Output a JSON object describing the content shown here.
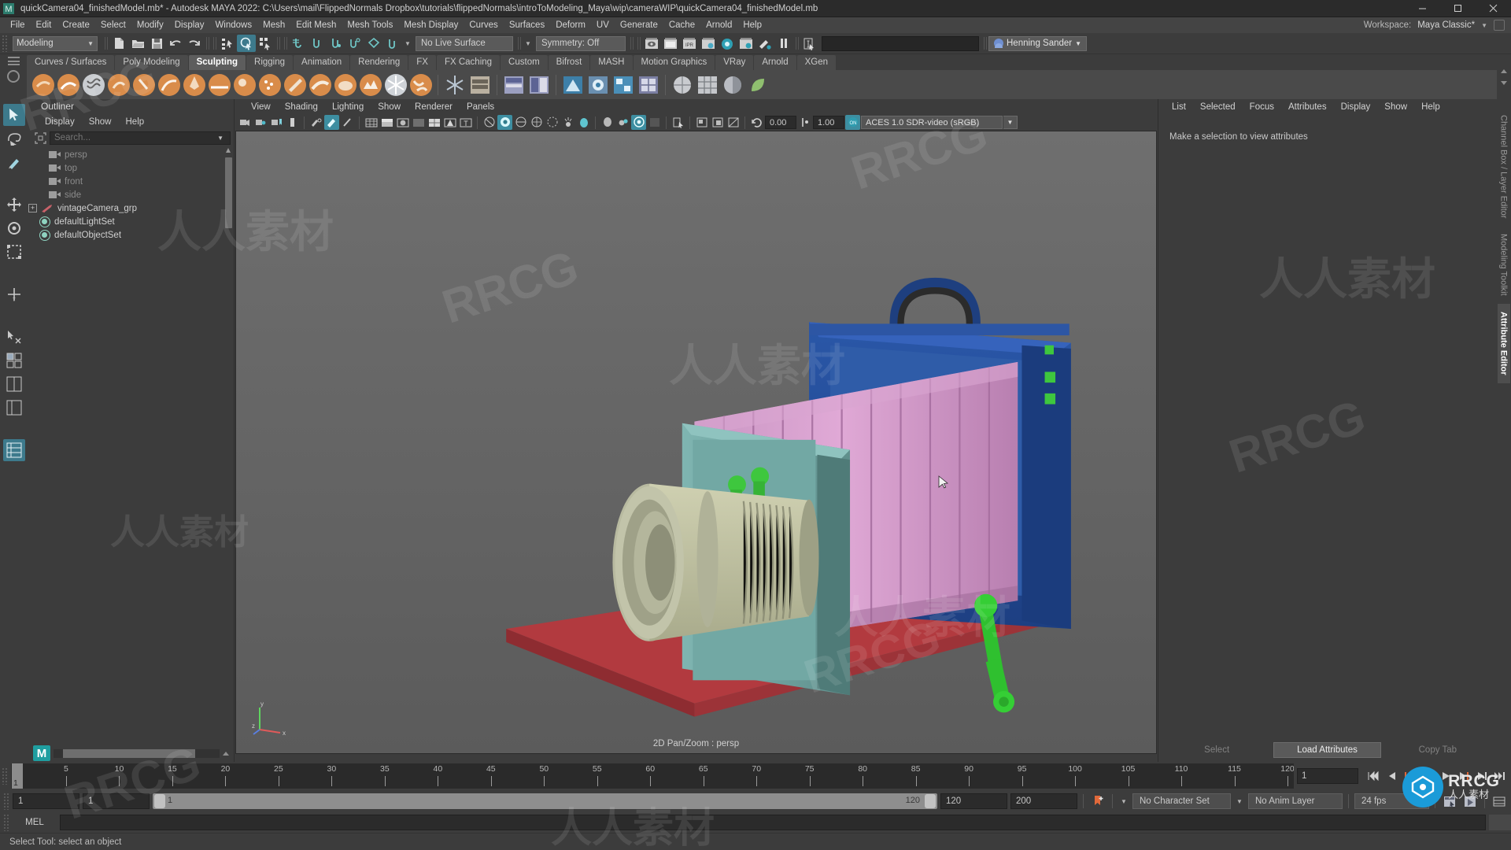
{
  "window": {
    "title": "quickCamera04_finishedModel.mb* - Autodesk MAYA 2022: C:\\Users\\mail\\FlippedNormals Dropbox\\tutorials\\flippedNormals\\introToModeling_Maya\\wip\\cameraWIP\\quickCamera04_finishedModel.mb",
    "minimize": "–",
    "maximize": "❐",
    "close": "✕"
  },
  "menubar": {
    "items": [
      "File",
      "Edit",
      "Create",
      "Select",
      "Modify",
      "Display",
      "Windows",
      "Mesh",
      "Edit Mesh",
      "Mesh Tools",
      "Mesh Display",
      "Curves",
      "Surfaces",
      "Deform",
      "UV",
      "Generate",
      "Cache",
      "Arnold",
      "Help"
    ],
    "workspace_label": "Workspace:",
    "workspace_value": "Maya Classic*"
  },
  "statusline": {
    "mode": "Modeling",
    "live_surface": "No Live Surface",
    "symmetry": "Symmetry: Off",
    "user": "Henning Sander",
    "quick_input_placeholder": ""
  },
  "shelf": {
    "tabs": [
      "Curves / Surfaces",
      "Poly Modeling",
      "Sculpting",
      "Rigging",
      "Animation",
      "Rendering",
      "FX",
      "FX Caching",
      "Custom",
      "Bifrost",
      "MASH",
      "Motion Graphics",
      "VRay",
      "Arnold",
      "XGen"
    ],
    "active_tab": "Sculpting"
  },
  "outliner": {
    "title": "Outliner",
    "menu": [
      "Display",
      "Show",
      "Help"
    ],
    "search_placeholder": "Search...",
    "search_value": "",
    "items": [
      {
        "label": "persp",
        "icon": "camera-icon",
        "dim": true,
        "expandable": false
      },
      {
        "label": "top",
        "icon": "camera-icon",
        "dim": true,
        "expandable": false
      },
      {
        "label": "front",
        "icon": "camera-icon",
        "dim": true,
        "expandable": false
      },
      {
        "label": "side",
        "icon": "camera-icon",
        "dim": true,
        "expandable": false
      },
      {
        "label": "vintageCamera_grp",
        "icon": "group-icon",
        "dim": false,
        "expandable": true
      },
      {
        "label": "defaultLightSet",
        "icon": "set-icon",
        "dim": false,
        "expandable": false
      },
      {
        "label": "defaultObjectSet",
        "icon": "set-icon",
        "dim": false,
        "expandable": false
      }
    ]
  },
  "viewport": {
    "menu": [
      "View",
      "Shading",
      "Lighting",
      "Show",
      "Renderer",
      "Panels"
    ],
    "exposure": "0.00",
    "gamma": "1.00",
    "color_space": "ACES 1.0 SDR-video (sRGB)",
    "label": "2D Pan/Zoom : persp",
    "axis_labels": {
      "y": "y",
      "x": "x",
      "z": "z"
    }
  },
  "attribute_editor": {
    "menu": [
      "List",
      "Selected",
      "Focus",
      "Attributes",
      "Display",
      "Show",
      "Help"
    ],
    "message": "Make a selection to view attributes",
    "buttons": {
      "select": "Select",
      "load": "Load Attributes",
      "copy": "Copy Tab"
    }
  },
  "side_tabs": [
    {
      "label": "Channel Box / Layer Editor",
      "active": false
    },
    {
      "label": "Modeling Toolkit",
      "active": false
    },
    {
      "label": "Attribute Editor",
      "active": true
    }
  ],
  "timeline": {
    "current_frame": "1",
    "start": 1,
    "end": 120,
    "tick_labels": [
      5,
      10,
      15,
      20,
      25,
      30,
      35,
      40,
      45,
      50,
      55,
      60,
      65,
      70,
      75,
      80,
      85,
      90,
      95,
      100,
      105,
      110,
      115,
      120
    ],
    "playback_field": "1"
  },
  "range_slider": {
    "anim_start": "1",
    "range_start": "1",
    "handle_start": "1",
    "handle_end": "120",
    "range_end": "120",
    "anim_end": "200",
    "character_set": "No Character Set",
    "anim_layer": "No Anim Layer",
    "fps": "24 fps"
  },
  "command_line": {
    "label": "MEL",
    "value": ""
  },
  "help_line": {
    "text": "Select Tool: select an object"
  },
  "watermark": {
    "brand": "RRCG",
    "cn": "人人素材",
    "badge_cn": "人人素材"
  },
  "colors": {
    "accent": "#3d8ea1",
    "bg": "#3c3c3c",
    "panel": "#4a4a4a",
    "viewport": "#656565"
  }
}
